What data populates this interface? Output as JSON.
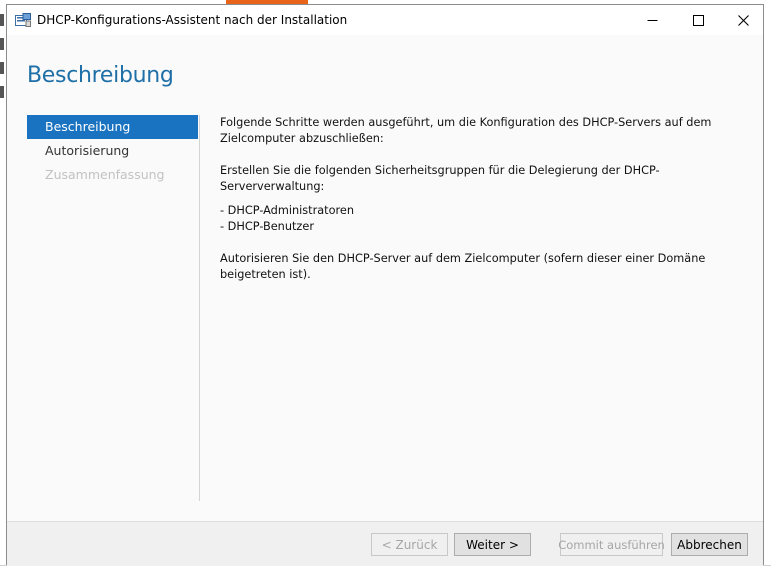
{
  "window": {
    "title": "DHCP-Konfigurations-Assistent nach der Installation",
    "controls": {
      "minimize_icon": "minimize-icon",
      "maximize_icon": "maximize-icon",
      "close_icon": "close-icon"
    }
  },
  "page": {
    "heading": "Beschreibung"
  },
  "nav": {
    "items": [
      {
        "label": "Beschreibung",
        "state": "active"
      },
      {
        "label": "Autorisierung",
        "state": "normal"
      },
      {
        "label": "Zusammenfassung",
        "state": "disabled"
      }
    ]
  },
  "content": {
    "intro": "Folgende Schritte werden ausgeführt, um die Konfiguration des DHCP-Servers auf dem Zielcomputer abzuschließen:",
    "groups_intro": "Erstellen Sie die folgenden Sicherheitsgruppen für die Delegierung der DHCP-Serververwaltung:",
    "groups": [
      "- DHCP-Administratoren",
      "- DHCP-Benutzer"
    ],
    "authorize": "Autorisieren Sie den DHCP-Server auf dem Zielcomputer (sofern dieser einer Domäne beigetreten ist)."
  },
  "footer": {
    "back_label": "< Zurück",
    "next_label": "Weiter >",
    "commit_label": "Commit ausführen",
    "cancel_label": "Abbrechen"
  },
  "colors": {
    "accent": "#1a73c1",
    "heading": "#1f6fa8",
    "disabled_text": "#c2c2c2",
    "background_orange": "#e8641b"
  }
}
